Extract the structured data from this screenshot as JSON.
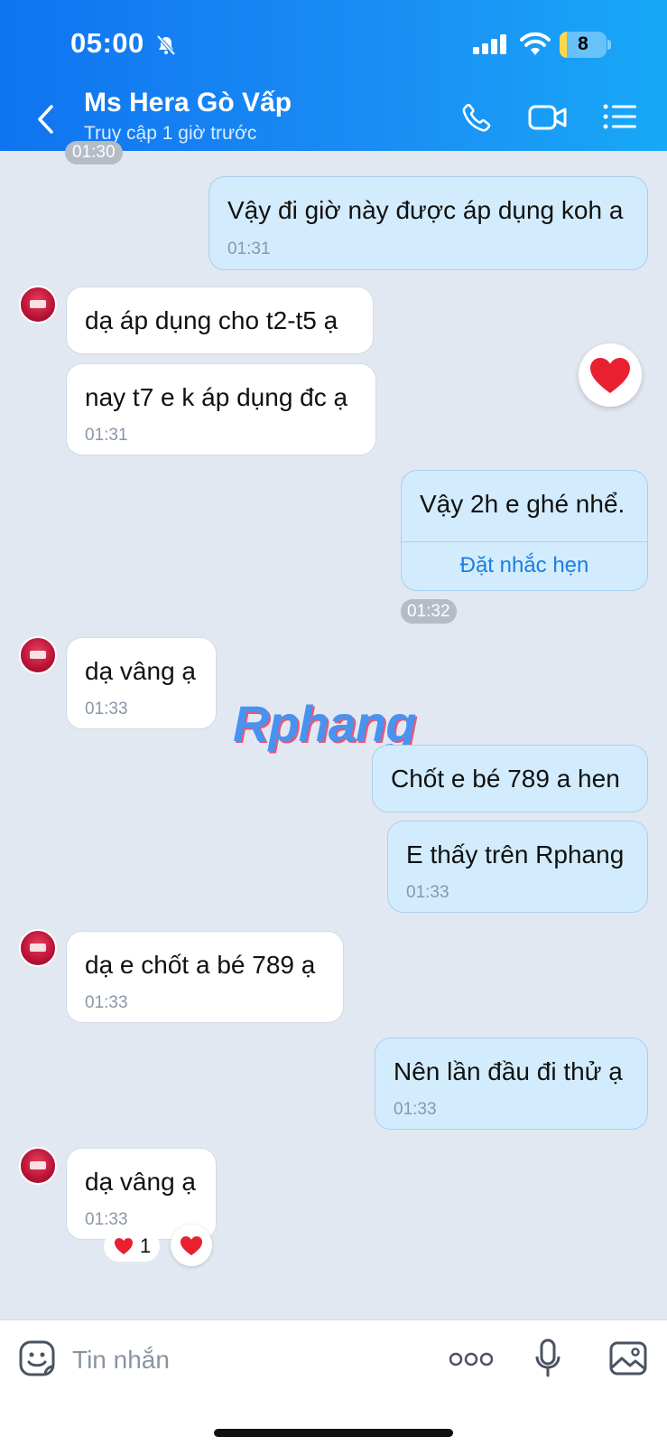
{
  "status_bar": {
    "time": "05:00",
    "battery": "8",
    "battery_level": 0.08
  },
  "header": {
    "contact_name": "Ms Hera Gò Vấp",
    "status": "Truy cập 1 giờ trước"
  },
  "top_time": "01:30",
  "messages": [
    {
      "side": "out",
      "text": "Vậy đi giờ này được áp dụng koh a",
      "time": "01:31"
    },
    {
      "side": "in",
      "text": "dạ áp dụng cho t2-t5 ạ"
    },
    {
      "side": "in",
      "text": "nay t7 e k áp dụng đc ạ",
      "time": "01:31"
    },
    {
      "side": "out",
      "text": "Vậy 2h e ghé nhể.",
      "action": "Đặt nhắc hẹn",
      "time": "01:32"
    },
    {
      "side": "in",
      "text": "dạ vâng ạ",
      "time": "01:33"
    },
    {
      "side": "out",
      "text": "Chốt e bé 789 a hen"
    },
    {
      "side": "out",
      "text": "E thấy trên Rphang",
      "time": "01:33"
    },
    {
      "side": "in",
      "text": "dạ e chốt a bé 789 ạ",
      "time": "01:33"
    },
    {
      "side": "out",
      "text": "Nên lần đầu đi thử ạ",
      "time": "01:33"
    },
    {
      "side": "in",
      "text": "dạ vâng ạ",
      "time": "01:33",
      "reaction_count": "1"
    }
  ],
  "watermark": "Rphang",
  "input": {
    "placeholder": "Tin nhắn"
  },
  "colors": {
    "header_start": "#0f74f0",
    "header_end": "#18a8f7",
    "outgoing_bubble": "#d3ecfd",
    "incoming_bubble": "#ffffff",
    "background": "#e2e8f1",
    "heart": "#e8202f"
  },
  "icons": [
    "back-icon",
    "phone-icon",
    "video-icon",
    "list-icon",
    "bell-muted-icon",
    "sticker-icon",
    "more-icon",
    "mic-icon",
    "image-icon",
    "heart-icon"
  ]
}
